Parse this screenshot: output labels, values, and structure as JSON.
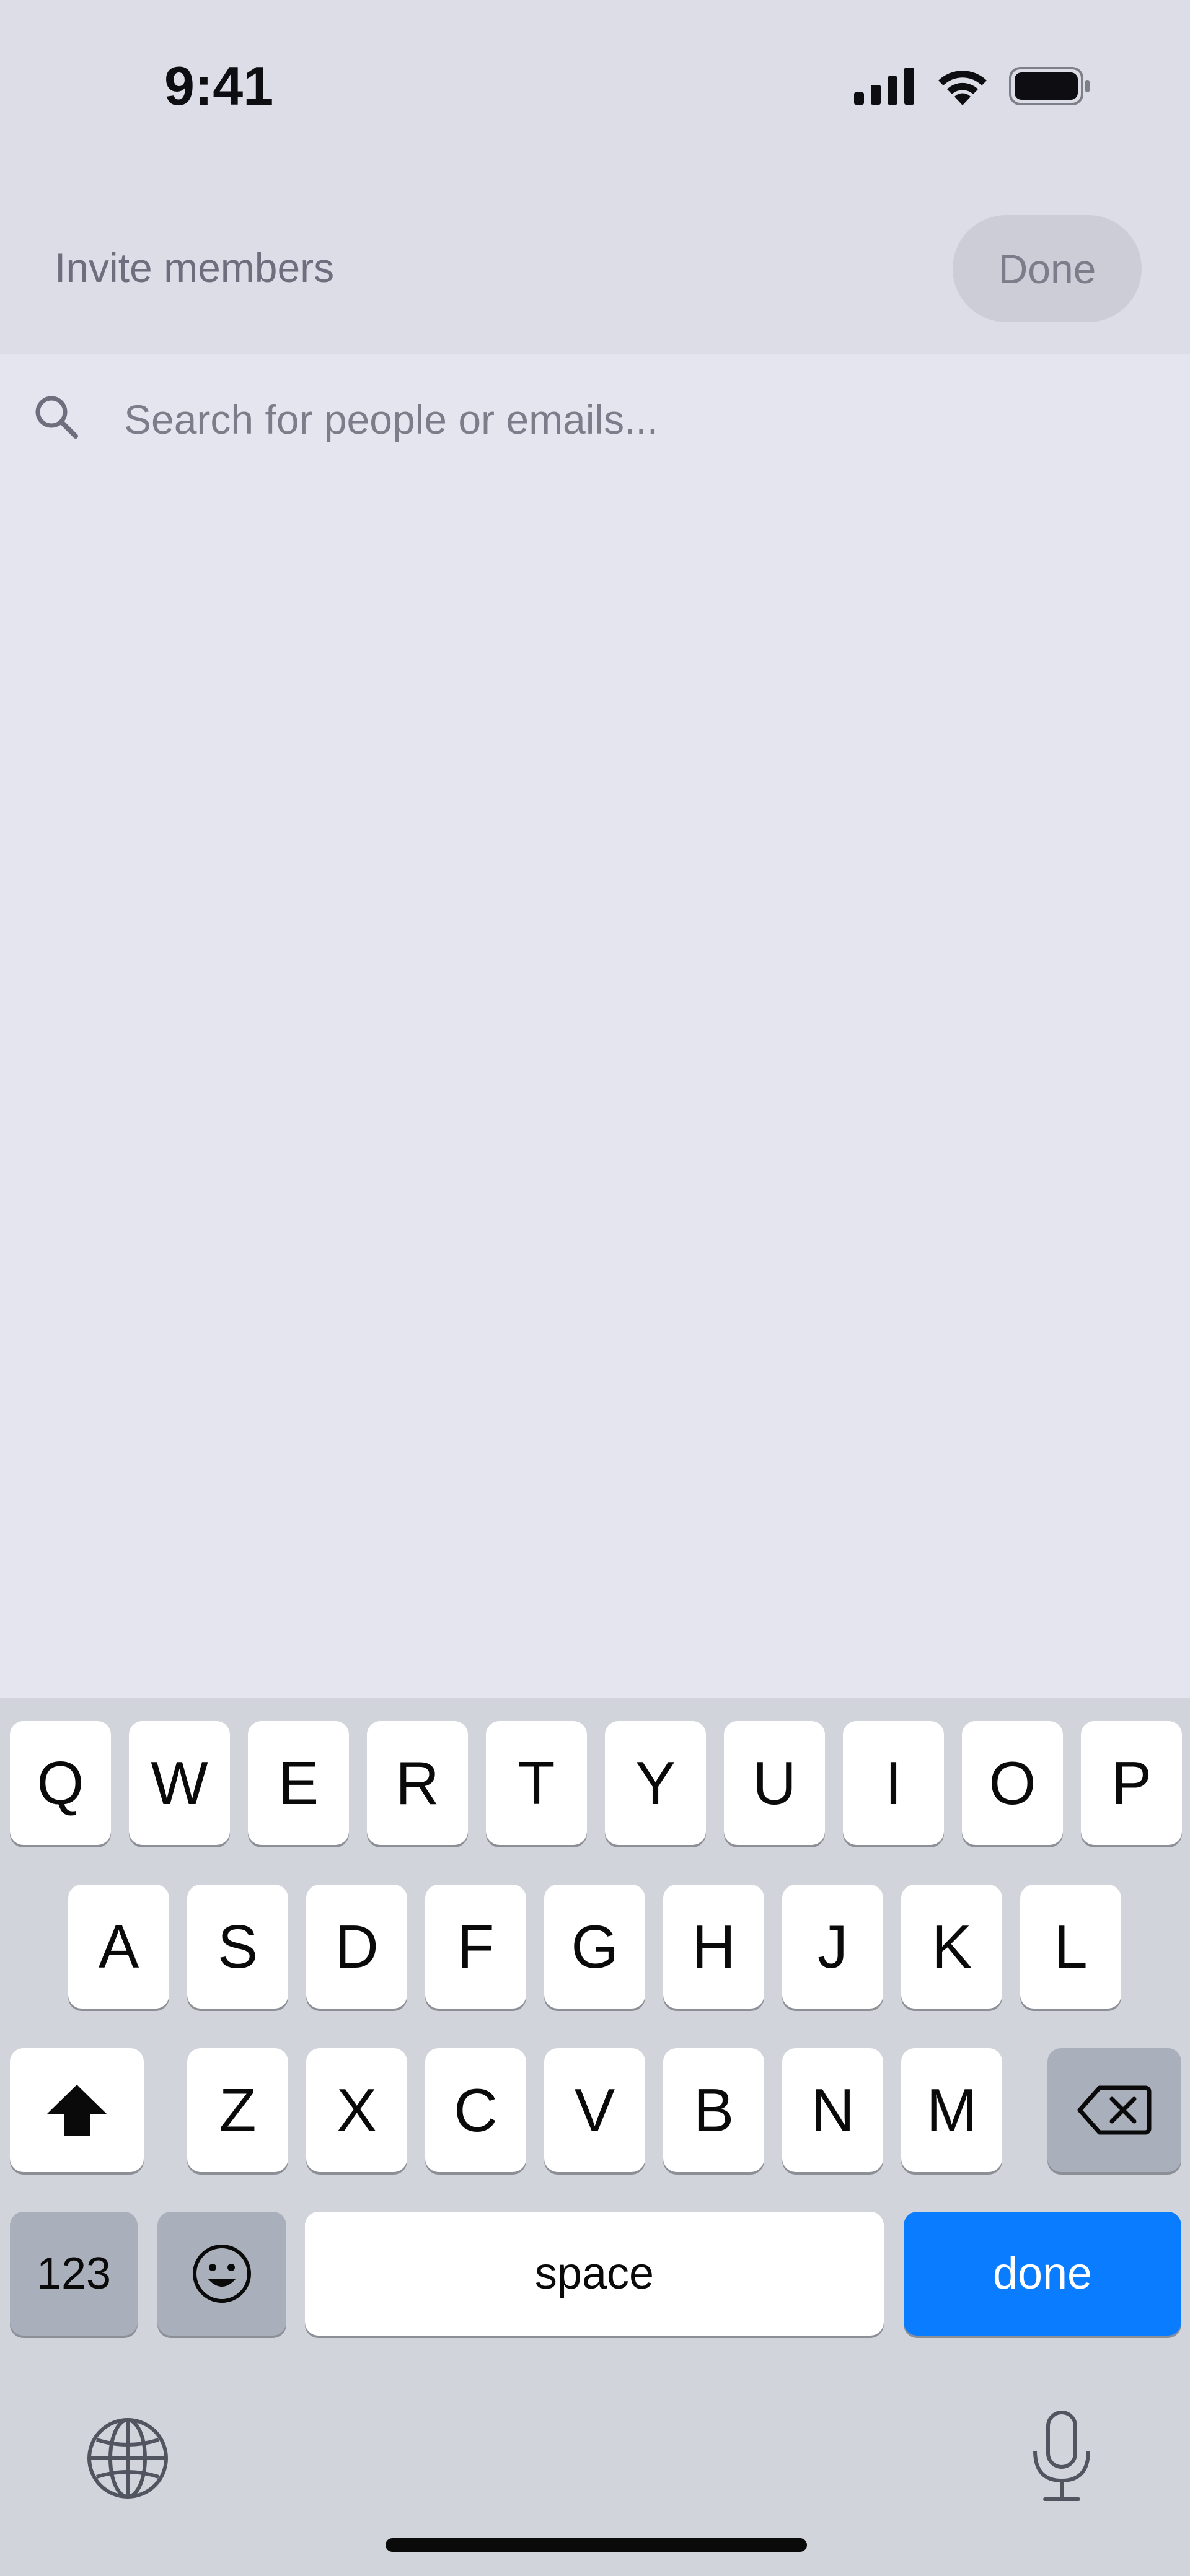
{
  "status_bar": {
    "time": "9:41"
  },
  "nav": {
    "title": "Invite members",
    "done_label": "Done"
  },
  "search": {
    "placeholder": "Search for people or emails...",
    "value": ""
  },
  "keyboard": {
    "row1": [
      "Q",
      "W",
      "E",
      "R",
      "T",
      "Y",
      "U",
      "I",
      "O",
      "P"
    ],
    "row2": [
      "A",
      "S",
      "D",
      "F",
      "G",
      "H",
      "J",
      "K",
      "L"
    ],
    "row3": [
      "Z",
      "X",
      "C",
      "V",
      "B",
      "N",
      "M"
    ],
    "numbers_label": "123",
    "space_label": "space",
    "done_label": "done"
  },
  "colors": {
    "accent": "#0a7cff",
    "background": "#e5e5ef",
    "nav_background": "#dddde8"
  },
  "icons": [
    "cellular-signal-icon",
    "wifi-icon",
    "battery-icon",
    "search-icon",
    "shift-icon",
    "backspace-icon",
    "emoji-icon",
    "globe-icon",
    "microphone-icon"
  ]
}
